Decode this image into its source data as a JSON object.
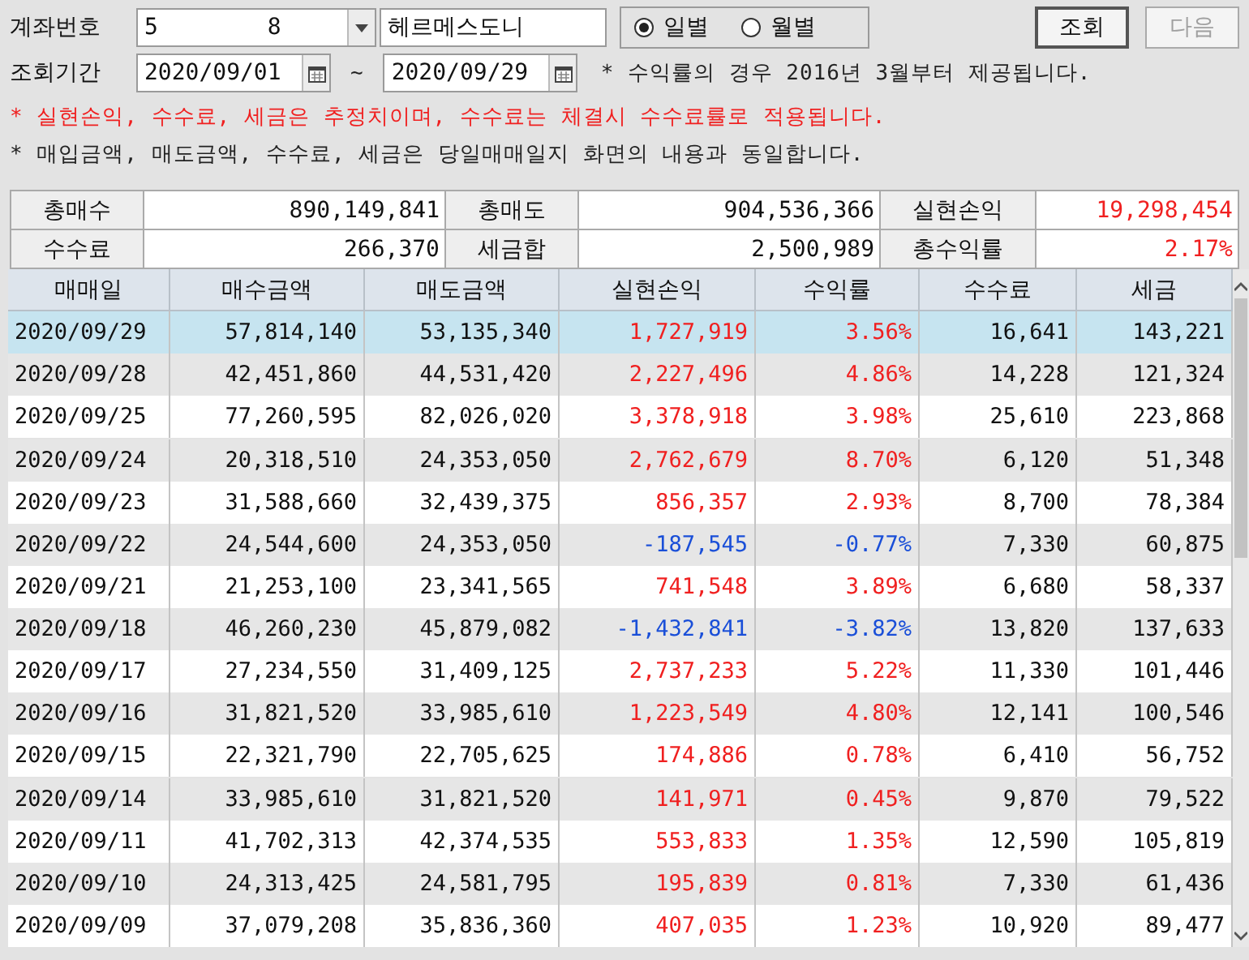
{
  "filters": {
    "account_label": "계좌번호",
    "account_value": "5        8",
    "account_name": "헤르메스도니",
    "period_options": [
      {
        "label": "일별",
        "selected": true
      },
      {
        "label": "월별",
        "selected": false
      }
    ],
    "search_button": "조회",
    "next_button": {
      "label": "다음",
      "disabled": true
    },
    "period_label": "조회기간",
    "start_date": "2020/09/01",
    "range_sep": "~",
    "end_date": "2020/09/29",
    "notes": [
      {
        "text": "* 수익률의 경우 2016년 3월부터 제공됩니다.",
        "kind": "info"
      },
      {
        "text": "* 실현손익, 수수료, 세금은 추정치이며, 수수료는 체결시 수수료률로 적용됩니다.",
        "kind": "warning"
      },
      {
        "text": "* 매입금액, 매도금액, 수수료, 세금은 당일매매일지 화면의 내용과 동일합니다.",
        "kind": "info"
      }
    ]
  },
  "summary": [
    [
      {
        "label": "총매수",
        "value": "890,149,841",
        "color": "#111111"
      },
      {
        "label": "총매도",
        "value": "904,536,366",
        "color": "#111111"
      },
      {
        "label": "실현손익",
        "value": "19,298,454",
        "color": "#f02020"
      }
    ],
    [
      {
        "label": "수수료",
        "value": "266,370",
        "color": "#111111"
      },
      {
        "label": "세금합",
        "value": "2,500,989",
        "color": "#111111"
      },
      {
        "label": "총수익률",
        "value": "2.17%",
        "color": "#f02020"
      }
    ]
  ],
  "table": {
    "columns": [
      "매매일",
      "매수금액",
      "매도금액",
      "실현손익",
      "수익률",
      "수수료",
      "세금"
    ],
    "rows": [
      {
        "cells": [
          "2020/09/29",
          "57,814,140",
          "53,135,340",
          "1,727,919",
          "3.56%",
          "16,641",
          "143,221"
        ],
        "color": "#f02020",
        "selected": true
      },
      {
        "cells": [
          "2020/09/28",
          "42,451,860",
          "44,531,420",
          "2,227,496",
          "4.86%",
          "14,228",
          "121,324"
        ],
        "color": "#f02020",
        "selected": false
      },
      {
        "cells": [
          "2020/09/25",
          "77,260,595",
          "82,026,020",
          "3,378,918",
          "3.98%",
          "25,610",
          "223,868"
        ],
        "color": "#f02020",
        "selected": false
      },
      {
        "cells": [
          "2020/09/24",
          "20,318,510",
          "24,353,050",
          "2,762,679",
          "8.70%",
          "6,120",
          "51,348"
        ],
        "color": "#f02020",
        "selected": false
      },
      {
        "cells": [
          "2020/09/23",
          "31,588,660",
          "32,439,375",
          "856,357",
          "2.93%",
          "8,700",
          "78,384"
        ],
        "color": "#f02020",
        "selected": false
      },
      {
        "cells": [
          "2020/09/22",
          "24,544,600",
          "24,353,050",
          "-187,545",
          "-0.77%",
          "7,330",
          "60,875"
        ],
        "color": "#1a4fd8",
        "selected": false
      },
      {
        "cells": [
          "2020/09/21",
          "21,253,100",
          "23,341,565",
          "741,548",
          "3.89%",
          "6,680",
          "58,337"
        ],
        "color": "#f02020",
        "selected": false
      },
      {
        "cells": [
          "2020/09/18",
          "46,260,230",
          "45,879,082",
          "-1,432,841",
          "-3.82%",
          "13,820",
          "137,633"
        ],
        "color": "#1a4fd8",
        "selected": false
      },
      {
        "cells": [
          "2020/09/17",
          "27,234,550",
          "31,409,125",
          "2,737,233",
          "5.22%",
          "11,330",
          "101,446"
        ],
        "color": "#f02020",
        "selected": false
      },
      {
        "cells": [
          "2020/09/16",
          "31,821,520",
          "33,985,610",
          "1,223,549",
          "4.80%",
          "12,141",
          "100,546"
        ],
        "color": "#f02020",
        "selected": false
      },
      {
        "cells": [
          "2020/09/15",
          "22,321,790",
          "22,705,625",
          "174,886",
          "0.78%",
          "6,410",
          "56,752"
        ],
        "color": "#f02020",
        "selected": false
      },
      {
        "cells": [
          "2020/09/14",
          "33,985,610",
          "31,821,520",
          "141,971",
          "0.45%",
          "9,870",
          "79,522"
        ],
        "color": "#f02020",
        "selected": false
      },
      {
        "cells": [
          "2020/09/11",
          "41,702,313",
          "42,374,535",
          "553,833",
          "1.35%",
          "12,590",
          "105,819"
        ],
        "color": "#f02020",
        "selected": false
      },
      {
        "cells": [
          "2020/09/10",
          "24,313,425",
          "24,581,795",
          "195,839",
          "0.81%",
          "7,330",
          "61,436"
        ],
        "color": "#f02020",
        "selected": false
      },
      {
        "cells": [
          "2020/09/09",
          "37,079,208",
          "35,836,360",
          "407,035",
          "1.23%",
          "10,920",
          "89,477"
        ],
        "color": "#f02020",
        "selected": false
      }
    ]
  }
}
